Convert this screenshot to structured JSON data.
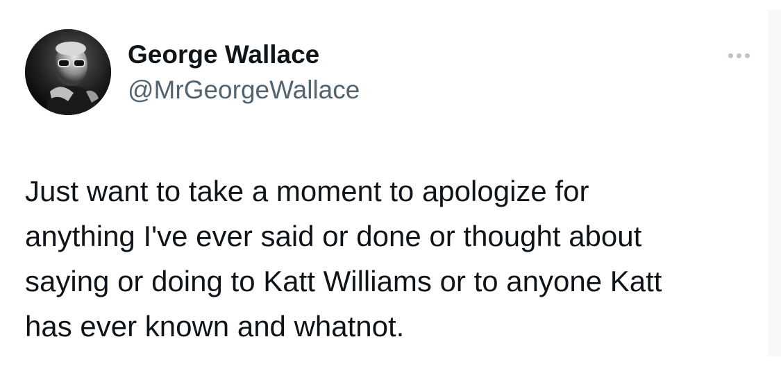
{
  "tweet": {
    "author": {
      "display_name": "George Wallace",
      "handle": "@MrGeorgeWallace"
    },
    "more_icon": "more-horizontal-icon",
    "text_lines": [
      "Just want to take a moment to apologize for",
      "anything I've ever said or done or thought about",
      "saying or doing to Katt Williams or to anyone Katt",
      "has ever known and whatnot."
    ]
  },
  "colors": {
    "text": "#0f1419",
    "secondary_text": "#536471",
    "more_dots": "#b9c4cc",
    "background": "#ffffff"
  }
}
